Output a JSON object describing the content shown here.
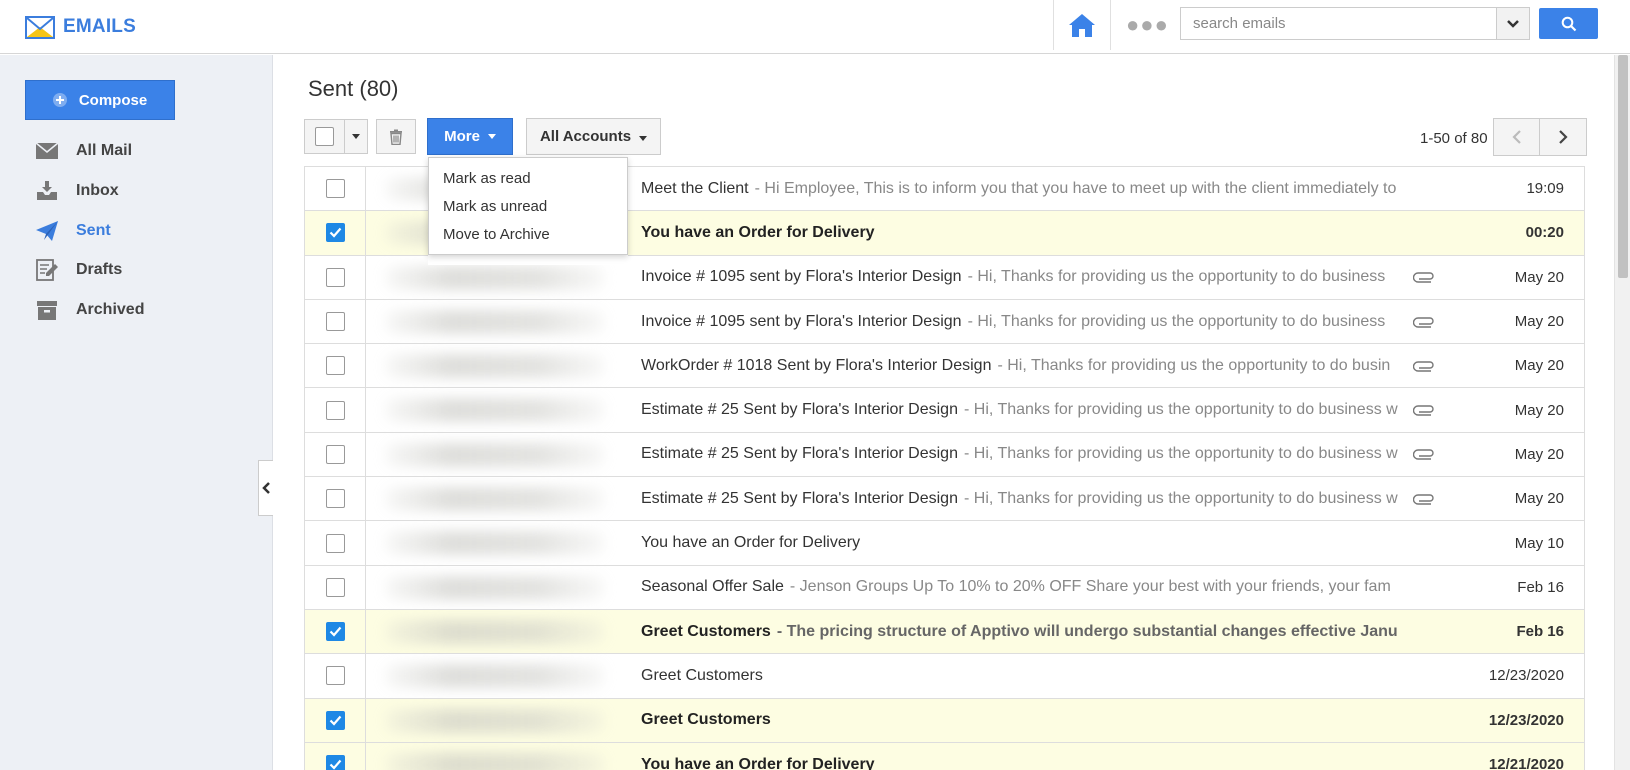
{
  "app": {
    "title": "EMAILS"
  },
  "search": {
    "placeholder": "search emails"
  },
  "sidebar": {
    "compose_label": "Compose",
    "items": [
      {
        "label": "All Mail",
        "icon": "envelope-icon"
      },
      {
        "label": "Inbox",
        "icon": "inbox-icon"
      },
      {
        "label": "Sent",
        "icon": "paper-plane-icon",
        "active": true
      },
      {
        "label": "Drafts",
        "icon": "drafts-icon"
      },
      {
        "label": "Archived",
        "icon": "archive-icon"
      }
    ]
  },
  "main": {
    "title": "Sent (80)",
    "toolbar": {
      "more_label": "More",
      "accounts_label": "All Accounts"
    },
    "pager": {
      "text": "1-50 of 80"
    },
    "more_menu": [
      "Mark as read",
      "Mark as unread",
      "Move to Archive"
    ]
  },
  "mails": [
    {
      "subject": "Meet the Client",
      "preview": "- Hi Employee, This is to inform you that you have to meet up with the client immediately to",
      "date": "19:09",
      "selected": false,
      "attachment": false
    },
    {
      "subject": "You have an Order for Delivery",
      "preview": "",
      "date": "00:20",
      "selected": true,
      "attachment": false
    },
    {
      "subject": "Invoice # 1095 sent by Flora's Interior Design",
      "preview": "- Hi,  Thanks for providing us the opportunity to do business",
      "date": "May 20",
      "selected": false,
      "attachment": true
    },
    {
      "subject": "Invoice # 1095 sent by Flora's Interior Design",
      "preview": "- Hi,  Thanks for providing us the opportunity to do business",
      "date": "May 20",
      "selected": false,
      "attachment": true
    },
    {
      "subject": "WorkOrder # 1018 Sent by Flora's Interior Design",
      "preview": "- Hi, Thanks for providing us the opportunity to do busin",
      "date": "May 20",
      "selected": false,
      "attachment": true
    },
    {
      "subject": "Estimate # 25 Sent by Flora's Interior Design",
      "preview": "- Hi,  Thanks for providing us the opportunity to do business w",
      "date": "May 20",
      "selected": false,
      "attachment": true
    },
    {
      "subject": "Estimate # 25 Sent by Flora's Interior Design",
      "preview": "- Hi,  Thanks for providing us the opportunity to do business w",
      "date": "May 20",
      "selected": false,
      "attachment": true
    },
    {
      "subject": "Estimate # 25 Sent by Flora's Interior Design",
      "preview": "- Hi,  Thanks for providing us the opportunity to do business w",
      "date": "May 20",
      "selected": false,
      "attachment": true
    },
    {
      "subject": "You have an Order for Delivery",
      "preview": "",
      "date": "May 10",
      "selected": false,
      "attachment": false
    },
    {
      "subject": "Seasonal Offer Sale",
      "preview": "- Jenson Groups Up To 10% to 20% OFF Share your best with your friends, your fam",
      "date": "Feb 16",
      "selected": false,
      "attachment": false
    },
    {
      "subject": "Greet Customers",
      "preview": "- The pricing structure of Apptivo will undergo substantial changes effective Janu",
      "date": "Feb 16",
      "selected": true,
      "attachment": false
    },
    {
      "subject": "Greet Customers",
      "preview": "",
      "date": "12/23/2020",
      "selected": false,
      "attachment": false
    },
    {
      "subject": "Greet Customers",
      "preview": "",
      "date": "12/23/2020",
      "selected": true,
      "attachment": false
    },
    {
      "subject": "You have an Order for Delivery",
      "preview": "",
      "date": "12/21/2020",
      "selected": true,
      "attachment": false
    }
  ],
  "colors": {
    "accent": "#3b82e8",
    "selected_row": "#fdfde2",
    "checkbox_on": "#1e88e5"
  }
}
